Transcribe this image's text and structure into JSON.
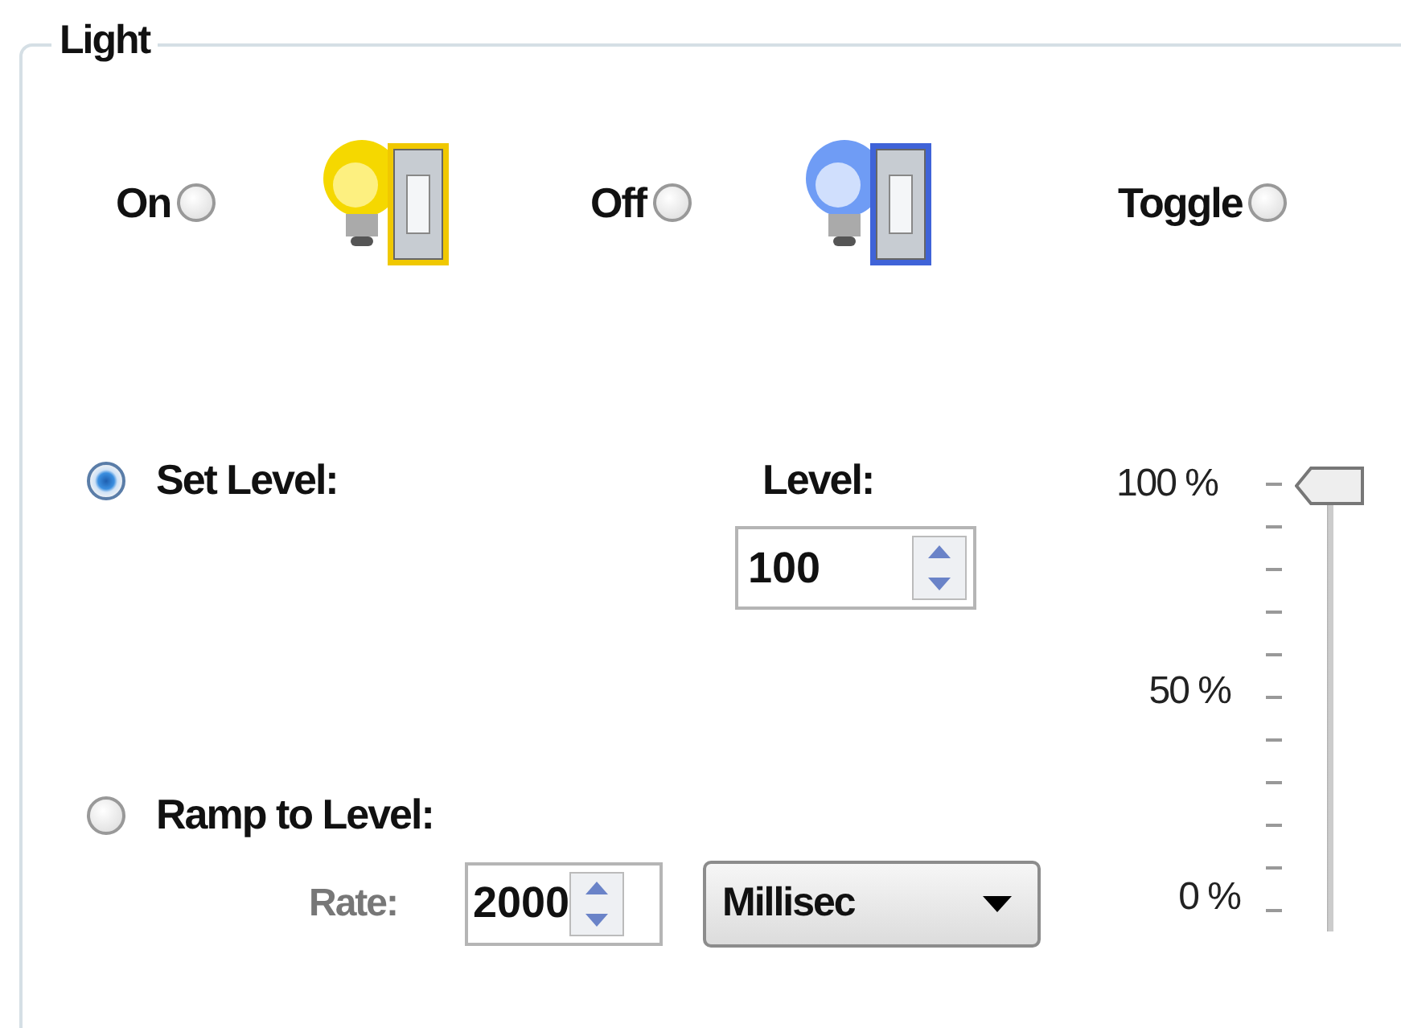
{
  "group": {
    "title": "Light"
  },
  "switch_options": [
    {
      "label": "On",
      "selected": false,
      "kind": "on"
    },
    {
      "label": "Off",
      "selected": false,
      "kind": "off"
    },
    {
      "label": "Toggle",
      "selected": false,
      "kind": "toggle"
    }
  ],
  "mode_options": [
    {
      "label": "Set Level:",
      "selected": true
    },
    {
      "label": "Ramp to Level:",
      "selected": false
    }
  ],
  "level": {
    "label": "Level:",
    "value": "100"
  },
  "rate": {
    "label": "Rate:",
    "disabled": true,
    "value": "2000",
    "unit": "Millisec"
  },
  "slider": {
    "level": 1.0,
    "tick_labels": [
      "100 %",
      "50 %",
      "0 %"
    ]
  }
}
